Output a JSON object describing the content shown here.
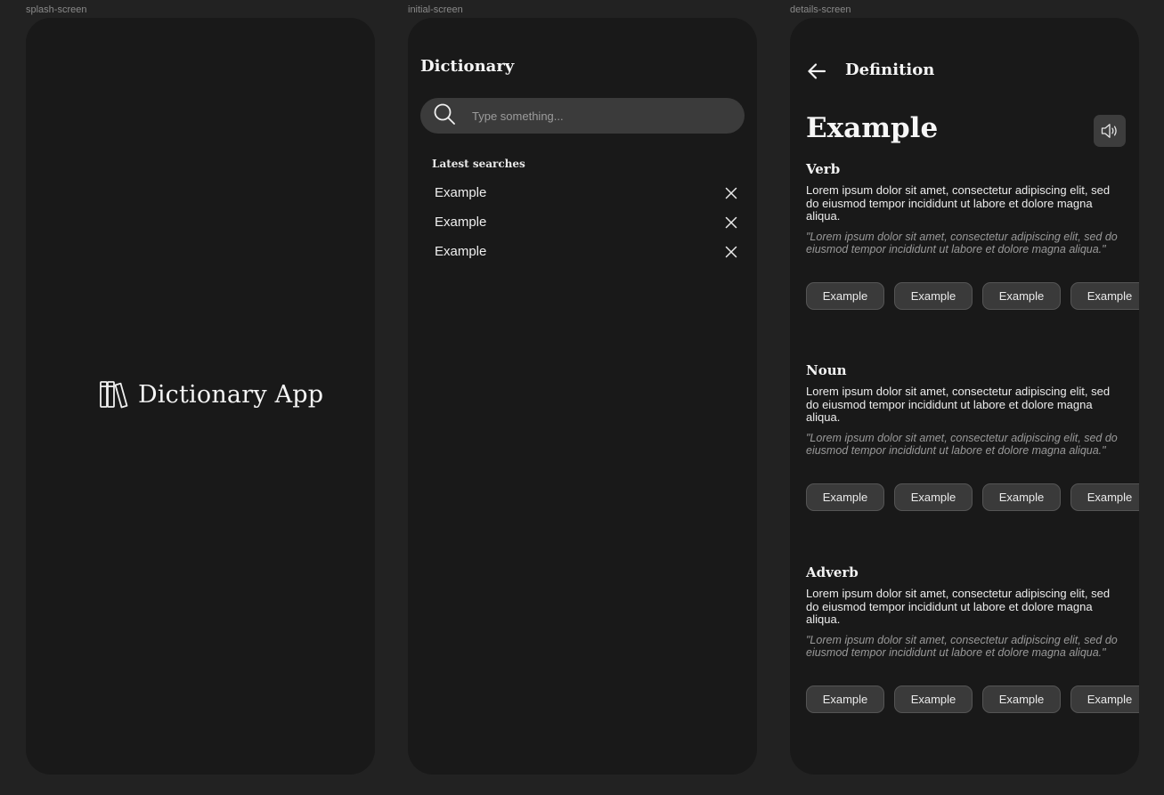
{
  "labels": {
    "splash": "splash-screen",
    "initial": "initial-screen",
    "details": "details-screen"
  },
  "splash": {
    "title": "Dictionary App",
    "logo_icon": "books-icon"
  },
  "initial": {
    "title": "Dictionary",
    "search": {
      "placeholder": "Type something...",
      "icon": "search-icon"
    },
    "latest_label": "Latest searches",
    "recent": [
      {
        "label": "Example"
      },
      {
        "label": "Example"
      },
      {
        "label": "Example"
      }
    ]
  },
  "details": {
    "header": "Definition",
    "word": "Example",
    "audio_icon": "speaker-icon",
    "sections": [
      {
        "pos": "Verb",
        "definition": "Lorem ipsum dolor sit amet, consectetur adipiscing elit, sed do eiusmod tempor incididunt ut labore et dolore magna aliqua.",
        "example": "\"Lorem ipsum dolor sit amet, consectetur adipiscing elit, sed do eiusmod tempor incididunt ut labore et dolore magna aliqua.\"",
        "chips": [
          "Example",
          "Example",
          "Example",
          "Example"
        ]
      },
      {
        "pos": "Noun",
        "definition": "Lorem ipsum dolor sit amet, consectetur adipiscing elit, sed do eiusmod tempor incididunt ut labore et dolore magna aliqua.",
        "example": "\"Lorem ipsum dolor sit amet, consectetur adipiscing elit, sed do eiusmod tempor incididunt ut labore et dolore magna aliqua.\"",
        "chips": [
          "Example",
          "Example",
          "Example",
          "Example"
        ]
      },
      {
        "pos": "Adverb",
        "definition": "Lorem ipsum dolor sit amet, consectetur adipiscing elit, sed do eiusmod tempor incididunt ut labore et dolore magna aliqua.",
        "example": "\"Lorem ipsum dolor sit amet, consectetur adipiscing elit, sed do eiusmod tempor incididunt ut labore et dolore magna aliqua.\"",
        "chips": [
          "Example",
          "Example",
          "Example",
          "Example"
        ]
      }
    ]
  },
  "colors": {
    "canvas": "#222222",
    "screen": "#191919",
    "search_bg": "#3b3b3b",
    "chip_bg": "#3a3a3a",
    "text": "#f2f2f2",
    "muted": "#9a9a9a"
  }
}
